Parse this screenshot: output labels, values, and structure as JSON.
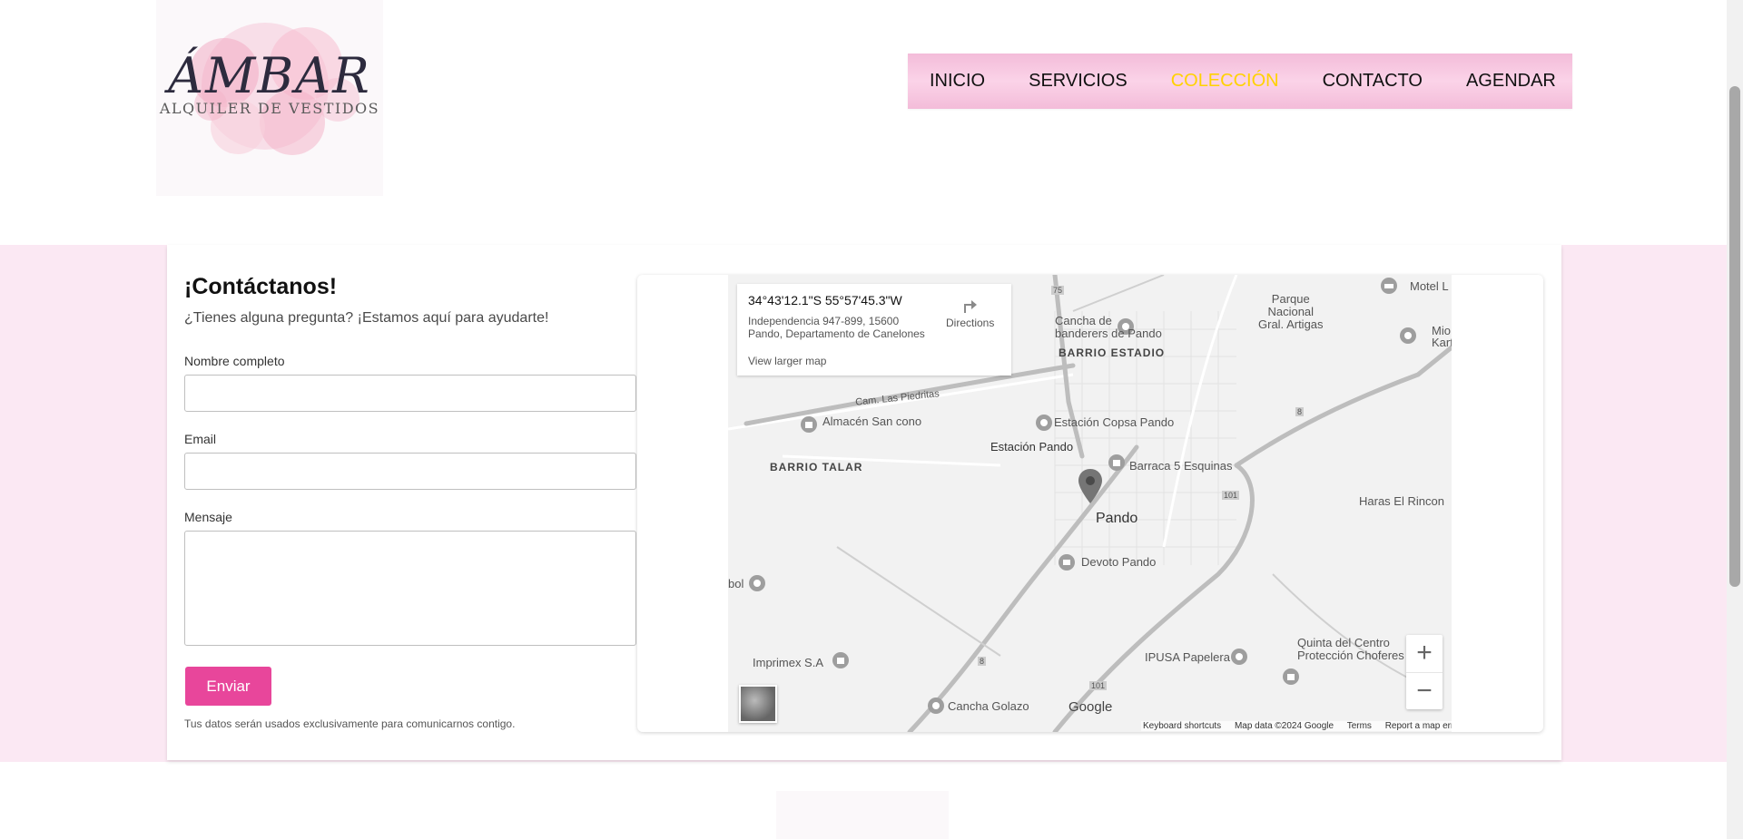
{
  "logo": {
    "main": "ÁMBAR",
    "sub": "ALQUILER DE VESTIDOS"
  },
  "nav": {
    "items": [
      "INICIO",
      "SERVICIOS",
      "COLECCIÓN",
      "CONTACTO",
      "AGENDAR"
    ],
    "active": "COLECCIÓN",
    "active_color": "#ffd200",
    "background": "#f8c6e0"
  },
  "contact": {
    "title": "¡Contáctanos!",
    "subtitle": "¿Tienes alguna pregunta? ¡Estamos aquí para ayudarte!",
    "name_label": "Nombre completo",
    "name_value": "",
    "email_label": "Email",
    "email_value": "",
    "message_label": "Mensaje",
    "message_value": "",
    "send_label": "Enviar",
    "send_color": "#e8469b",
    "privacy_note": "Tus datos serán usados exclusivamente para comunicarnos contigo."
  },
  "map": {
    "coords": "34°43'12.1\"S 55°57'45.3\"W",
    "address_line1": "Independencia 947-899, 15600",
    "address_line2": "Pando, Departamento de Canelones",
    "directions_label": "Directions",
    "larger_map_label": "View larger map",
    "zoom_in": "+",
    "zoom_out": "−",
    "google": "Google",
    "attribution": {
      "shortcuts": "Keyboard shortcuts",
      "data": "Map data ©2024 Google",
      "terms": "Terms",
      "report": "Report a map error"
    },
    "labels": {
      "cancha": "Cancha de\nbanderers de Pando",
      "parque": "Parque\nNacional\nGral. Artigas",
      "motel": "Motel L",
      "mio": "Mio\nKart",
      "barrio_estadio": "BARRIO ESTADIO",
      "camino": "Cam. Las Piedritas",
      "almacen": "Almacén San cono",
      "copsa": "Estación Copsa Pando",
      "estacion": "Estación Pando",
      "barrio_talar": "BARRIO TALAR",
      "barraca": "Barraca 5 Esquinas",
      "pando": "Pando",
      "haras": "Haras El Rincon",
      "devoto": "Devoto Pando",
      "bol": "bol",
      "imprimex": "Imprimex S.A",
      "ipusa": "IPUSA Papelera",
      "quinta": "Quinta del Centro\nProtección Choferes de...",
      "golazo": "Cancha Golazo",
      "route_75": "75",
      "route_8": "8",
      "route_101": "101",
      "route_8b": "8",
      "route_101b": "101"
    }
  }
}
